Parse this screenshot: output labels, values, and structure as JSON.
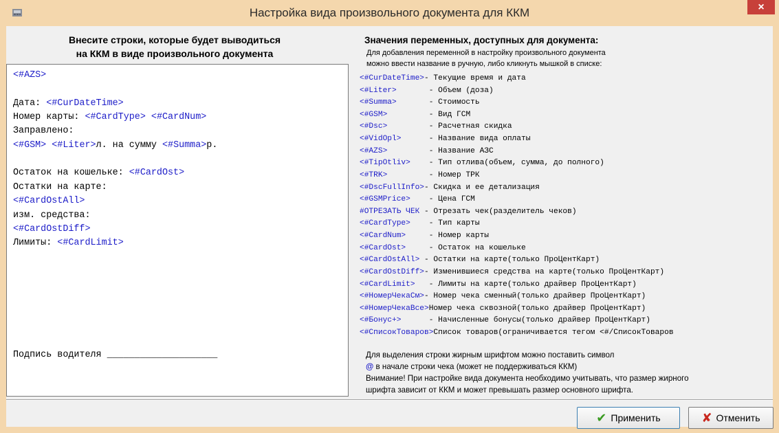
{
  "window": {
    "title": "Настройка вида произвольного документа для ККМ",
    "close_label": "×"
  },
  "left_panel": {
    "header_line1": "Внесите строки, которые будет выводиться",
    "header_line2": "на ККМ в виде произвольного документа"
  },
  "editor": {
    "lines": [
      [
        {
          "t": "<#AZS>",
          "tag": true
        }
      ],
      [],
      [
        {
          "t": "Дата: "
        },
        {
          "t": "<#CurDateTime>",
          "tag": true
        }
      ],
      [
        {
          "t": "Номер карты: "
        },
        {
          "t": "<#CardType>",
          "tag": true
        },
        {
          "t": " "
        },
        {
          "t": "<#CardNum>",
          "tag": true
        }
      ],
      [
        {
          "t": "Заправлено:"
        }
      ],
      [
        {
          "t": "<#GSM>",
          "tag": true
        },
        {
          "t": " "
        },
        {
          "t": "<#Liter>",
          "tag": true
        },
        {
          "t": "л. на сумму "
        },
        {
          "t": "<#Summa>",
          "tag": true
        },
        {
          "t": "р."
        }
      ],
      [],
      [
        {
          "t": "Остаток на кошельке: "
        },
        {
          "t": "<#CardOst>",
          "tag": true
        }
      ],
      [
        {
          "t": "Остатки на карте:"
        }
      ],
      [
        {
          "t": "<#CardOstAll>",
          "tag": true
        }
      ],
      [
        {
          "t": "изм. средства:"
        }
      ],
      [
        {
          "t": "<#CardOstDiff>",
          "tag": true
        }
      ],
      [
        {
          "t": "Лимиты: "
        },
        {
          "t": "<#CardLimit>",
          "tag": true
        }
      ],
      [],
      [],
      [],
      [],
      [],
      [],
      [],
      [
        {
          "t": "Подпись водителя ____________________"
        }
      ]
    ]
  },
  "variables_panel": {
    "title": "Значения переменных, доступных для документа:",
    "subtitle_line1": "Для добавления переменной в настройку произвольного документа",
    "subtitle_line2": "можно ввести название в ручную, либо кликнуть мышкой в списке:",
    "items": [
      {
        "name": "<#CurDateTime>",
        "pad": "",
        "desc": "- Текущие время и дата"
      },
      {
        "name": "<#Liter>",
        "pad": "       ",
        "desc": "- Объем (доза)"
      },
      {
        "name": "<#Summa>",
        "pad": "       ",
        "desc": "- Стоимость"
      },
      {
        "name": "<#GSM>",
        "pad": "         ",
        "desc": "- Вид ГСМ"
      },
      {
        "name": "<#Dsc>",
        "pad": "         ",
        "desc": "- Расчетная скидка"
      },
      {
        "name": "<#VidOpl>",
        "pad": "      ",
        "desc": "- Название вида оплаты"
      },
      {
        "name": "<#AZS>",
        "pad": "         ",
        "desc": "- Название АЗС"
      },
      {
        "name": "<#TipOtliv>",
        "pad": "    ",
        "desc": "- Тип отлива(объем, сумма, до полного)"
      },
      {
        "name": "<#TRK>",
        "pad": "         ",
        "desc": "- Номер ТРК"
      },
      {
        "name": "<#DscFullInfo>",
        "pad": "",
        "desc": "- Скидка и ее детализация"
      },
      {
        "name": "<#GSMPrice>",
        "pad": "    ",
        "desc": "- Цена ГСМ"
      },
      {
        "name": "#ОТРЕЗАТЬ ЧЕК",
        "pad": " ",
        "desc": "- Отрезать чек(разделитель чеков)"
      },
      {
        "name": "<#CardType>",
        "pad": "    ",
        "desc": "- Тип карты"
      },
      {
        "name": "<#CardNum>",
        "pad": "     ",
        "desc": "- Номер карты"
      },
      {
        "name": "<#CardOst>",
        "pad": "     ",
        "desc": "- Остаток на кошельке"
      },
      {
        "name": "<#CardOstAll>",
        "pad": " ",
        "desc": "- Остатки на карте(только ПроЦентКарт)"
      },
      {
        "name": "<#CardOstDiff>",
        "pad": "",
        "desc": "- Изменившиеся средства на карте(только ПроЦентКарт)"
      },
      {
        "name": "<#CardLimit>",
        "pad": "   ",
        "desc": "- Лимиты на карте(только драйвер ПроЦентКарт)"
      },
      {
        "name": "<#НомерЧекаСм>",
        "pad": "",
        "desc": "- Номер чека сменный(только драйвер ПроЦентКарт)"
      },
      {
        "name": "<#НомерЧекаВсе>",
        "pad": "",
        "desc": "Номер чека сквозной(только драйвер ПроЦентКарт)"
      },
      {
        "name": "<#Бонус+>",
        "pad": "      ",
        "desc": "- Начисленные бонусы(только драйвер ПроЦентКарт)"
      },
      {
        "name": "<#СписокТоваров>",
        "pad": "",
        "desc": "Список товаров(ограничивается тегом <#/СписокТоваров"
      }
    ]
  },
  "notes": {
    "line1": "Для выделения строки жирным шрифтом можно поставить символ",
    "line2_symbol": "@",
    "line2_text": " в начале строки чека (может не поддерживаться ККМ)",
    "line3": "Внимание! При настройке вида документа необходимо учитывать, что размер жирного",
    "line4": "шрифта зависит от ККМ и может превышать размер основного шрифта."
  },
  "buttons": {
    "apply_label": "Применить",
    "cancel_label": "Отменить"
  }
}
